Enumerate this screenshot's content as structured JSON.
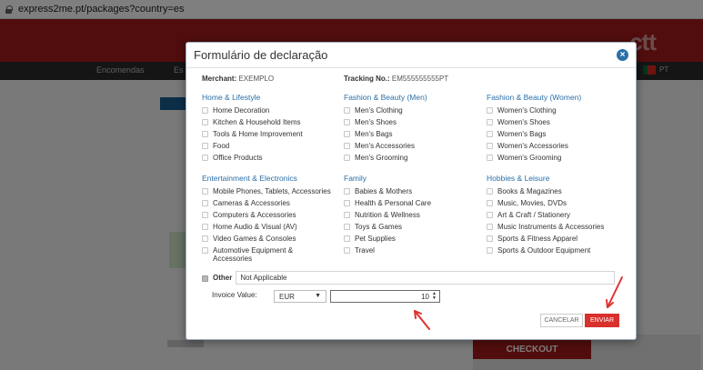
{
  "browser": {
    "url": "express2me.pt/packages?country=es"
  },
  "site": {
    "logo": "ctt",
    "nav": [
      "Encomendas",
      "Es"
    ],
    "lang": "PT",
    "checkout": "CHECKOUT"
  },
  "modal": {
    "title": "Formulário de declaração",
    "close_label": "×",
    "merchant_label": "Merchant:",
    "merchant_value": "EXEMPLO",
    "tracking_label": "Tracking No.:",
    "tracking_value": "EM555555555PT",
    "categories": [
      {
        "title": "Home & Lifestyle",
        "items": [
          "Home Decoration",
          "Kitchen & Household Items",
          "Tools & Home Improvement",
          "Food",
          "Office Products"
        ]
      },
      {
        "title": "Fashion & Beauty (Men)",
        "items": [
          "Men's Clothing",
          "Men's Shoes",
          "Men's Bags",
          "Men's Accessories",
          "Men's Grooming"
        ]
      },
      {
        "title": "Fashion & Beauty (Women)",
        "items": [
          "Women's Clothing",
          "Women's Shoes",
          "Women's Bags",
          "Women's Accessories",
          "Women's Grooming"
        ]
      },
      {
        "title": "Entertainment & Electronics",
        "items": [
          "Mobile Phones, Tablets, Accessories",
          "Cameras & Accessories",
          "Computers & Accessories",
          "Home Audio & Visual (AV)",
          "Video Games & Consoles",
          "Automotive Equipment & Accessories"
        ]
      },
      {
        "title": "Family",
        "items": [
          "Babies & Mothers",
          "Health & Personal Care",
          "Nutrition & Wellness",
          "Toys & Games",
          "Pet Supplies",
          "Travel"
        ]
      },
      {
        "title": "Hobbies & Leisure",
        "items": [
          "Books & Magazines",
          "Music, Movies, DVDs",
          "Art & Craft / Stationery",
          "Music Instruments & Accessories",
          "Sports & Fitness Apparel",
          "Sports & Outdoor Equipment"
        ]
      }
    ],
    "other_label": "Other",
    "other_value": "Not Applicable",
    "invoice_label": "Invoice Value:",
    "currency": "EUR",
    "amount": "10",
    "cancel_label": "CANCELAR",
    "send_label": "ENVIAR"
  },
  "colors": {
    "brand_red": "#a31b1b",
    "link_blue": "#2a6fa8",
    "send_red": "#d9302c",
    "annotation_red": "#e03030"
  }
}
